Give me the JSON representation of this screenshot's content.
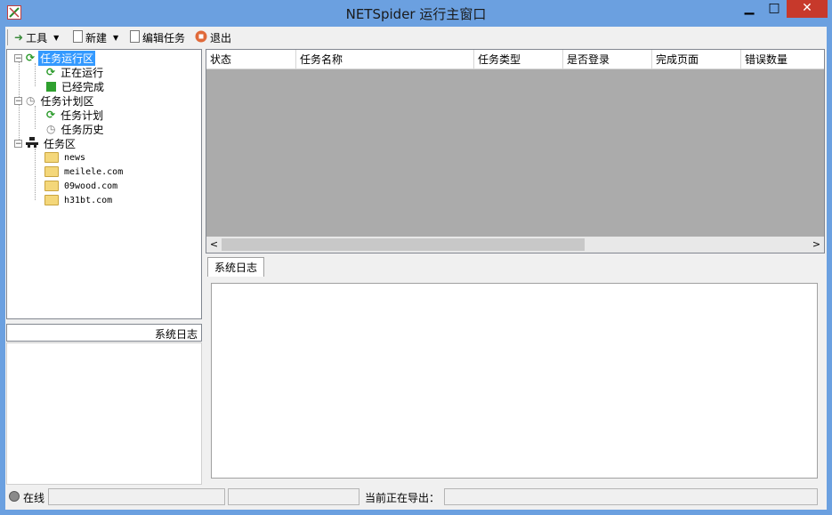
{
  "window": {
    "title": "NETSpider 运行主窗口",
    "min": "▁",
    "max": "□",
    "close": "✕"
  },
  "toolbar": {
    "tools": "工具",
    "new": "新建",
    "edit_task": "编辑任务",
    "exit": "退出"
  },
  "tree": {
    "running_area": "任务运行区",
    "running": "正在运行",
    "completed": "已经完成",
    "plan_area": "任务计划区",
    "task_plan": "任务计划",
    "task_history": "任务历史",
    "task_area": "任务区",
    "tasks": [
      "news",
      "meilele.com",
      "09wood.com",
      "h31bt.com"
    ]
  },
  "left_log": {
    "title": "系统日志"
  },
  "grid": {
    "columns": [
      "状态",
      "任务名称",
      "任务类型",
      "是否登录",
      "完成页面",
      "错误数量"
    ]
  },
  "right_log": {
    "tab": "系统日志"
  },
  "statusbar": {
    "online": "在线",
    "exporting": "当前正在导出："
  },
  "colors": {
    "titlebar": "#6ba0e0",
    "selection": "#3399ff",
    "close": "#c7392b",
    "grid_bg": "#ababab"
  }
}
